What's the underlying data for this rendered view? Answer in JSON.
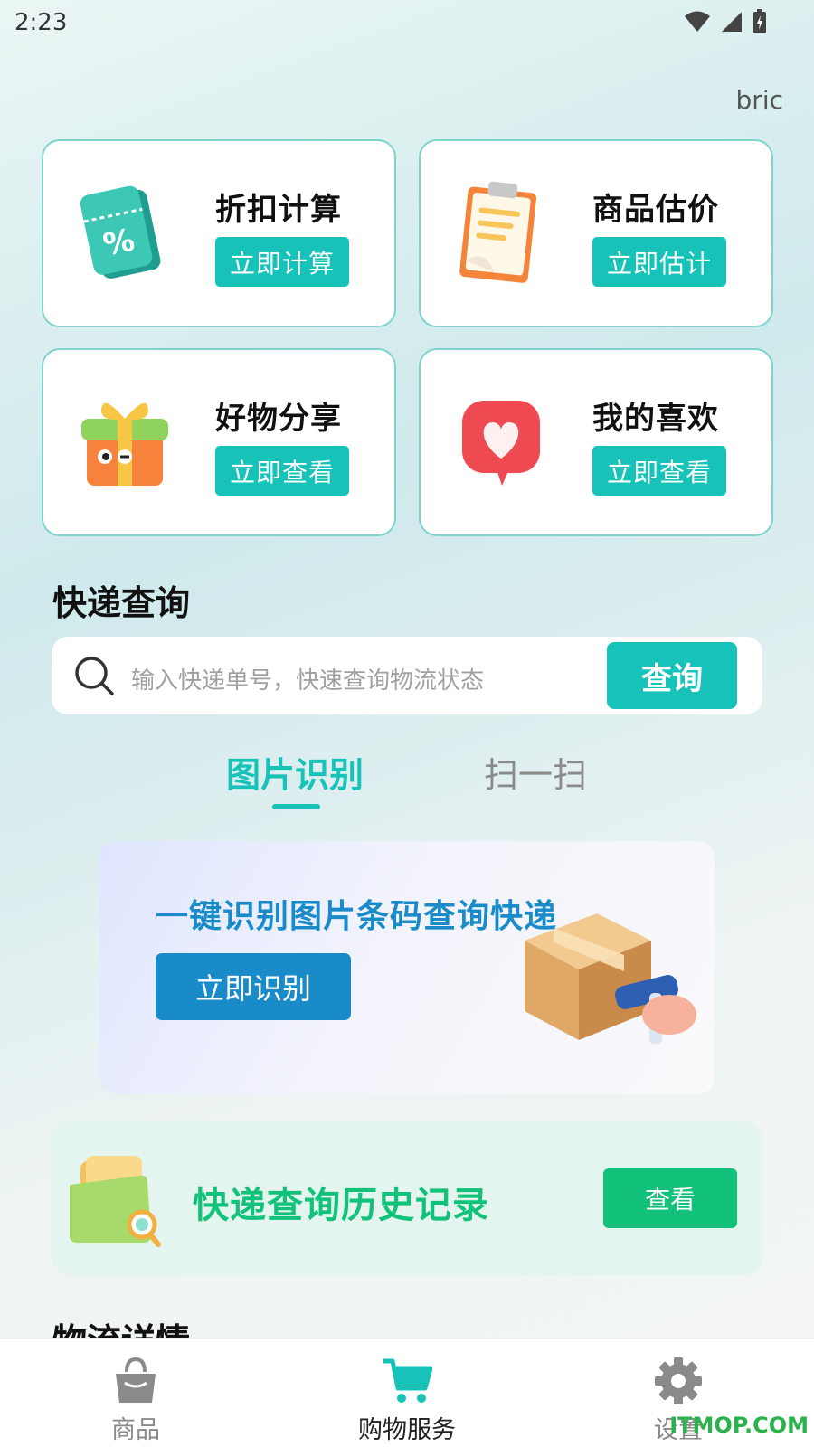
{
  "status_bar": {
    "time": "2:23"
  },
  "user": {
    "name": "bric"
  },
  "features": [
    {
      "title": "折扣计算",
      "button": "立即计算",
      "icon": "discount-ticket-icon"
    },
    {
      "title": "商品估价",
      "button": "立即估计",
      "icon": "clipboard-icon"
    },
    {
      "title": "好物分享",
      "button": "立即查看",
      "icon": "gift-box-icon"
    },
    {
      "title": "我的喜欢",
      "button": "立即查看",
      "icon": "heart-bubble-icon"
    }
  ],
  "express": {
    "section_title": "快递查询",
    "search_placeholder": "输入快递单号，快速查询物流状态",
    "search_button": "查询"
  },
  "tabs": [
    {
      "label": "图片识别",
      "active": true
    },
    {
      "label": "扫一扫",
      "active": false
    }
  ],
  "banner": {
    "text": "一键识别图片条码查询快递",
    "button": "立即识别"
  },
  "history": {
    "text": "快递查询历史记录",
    "button": "查看"
  },
  "logistics": {
    "section_title": "物流详情"
  },
  "bottom_nav": [
    {
      "label": "商品",
      "icon": "shopping-bag-icon",
      "active": false
    },
    {
      "label": "购物服务",
      "icon": "shopping-cart-icon",
      "active": true
    },
    {
      "label": "设置",
      "icon": "gear-icon",
      "active": false
    }
  ],
  "watermark": "ITMOP.COM",
  "colors": {
    "accent": "#17c3b8",
    "banner_blue": "#1a8bc9",
    "history_green": "#12c17a"
  }
}
